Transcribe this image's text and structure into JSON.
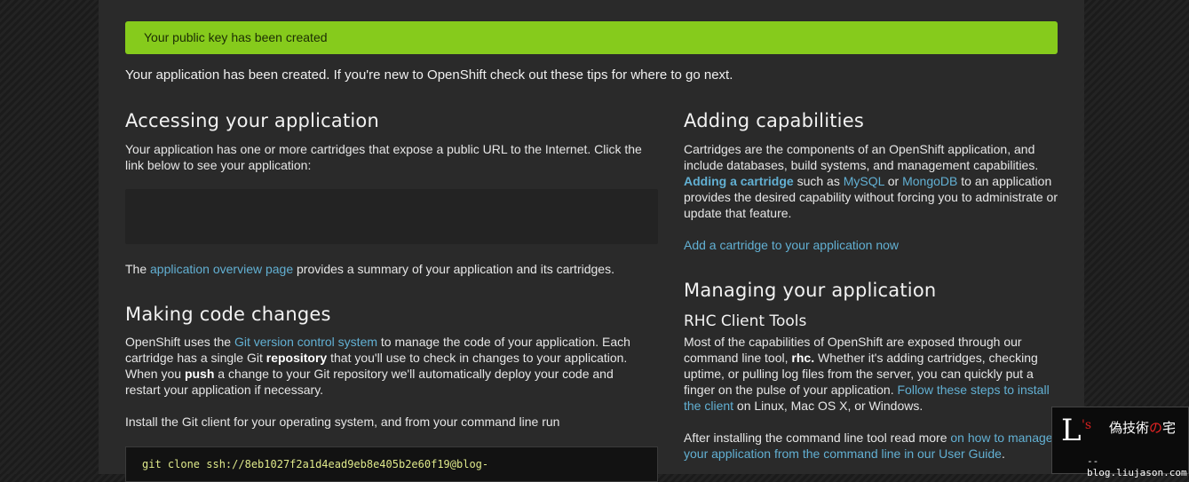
{
  "alert": {
    "text": "Your public key has been created"
  },
  "intro": "Your application has been created. If you're new to OpenShift check out these tips for where to go next.",
  "accessing": {
    "heading": "Accessing your application",
    "desc": "Your application has one or more cartridges that expose a public URL to the Internet. Click the link below to see your application:",
    "overview_prefix": "The ",
    "overview_link": "application overview page",
    "overview_suffix": " provides a summary of your application and its cartridges."
  },
  "code_changes": {
    "heading": "Making code changes",
    "p1_a": "OpenShift uses the ",
    "p1_link": "Git version control system",
    "p1_b": " to manage the code of your application. Each cartridge has a single Git ",
    "p1_bold1": "repository",
    "p1_c": " that you'll use to check in changes to your application. When you ",
    "p1_bold2": "push",
    "p1_d": " a change to your Git repository we'll automatically deploy your code and restart your application if necessary.",
    "p2": "Install the Git client for your operating system, and from your command line run",
    "command": "git clone ssh://8eb1027f2a1d4ead9eb8e405b2e60f19@blog-"
  },
  "capabilities": {
    "heading": "Adding capabilities",
    "p_a": "Cartridges are the components of an OpenShift application, and include databases, build systems, and management capabilities. ",
    "p_link_bold": "Adding a cartridge",
    "p_b": " such as ",
    "p_link_mysql": "MySQL",
    "p_c": " or ",
    "p_link_mongo": "MongoDB",
    "p_d": " to an application provides the desired capability without forcing you to administrate or update that feature.",
    "action_link": "Add a cartridge to your application now"
  },
  "managing": {
    "heading": "Managing your application",
    "subheading": "RHC Client Tools",
    "p1_a": "Most of the capabilities of OpenShift are exposed through our command line tool, ",
    "p1_bold": "rhc.",
    "p1_b": " Whether it's adding cartridges, checking uptime, or pulling log files from the server, you can quickly put a finger on the pulse of your application. ",
    "p1_link": "Follow these steps to install the client",
    "p1_c": " on Linux, Mac OS X, or Windows.",
    "p2_a": "After installing the command line tool read more ",
    "p2_link": "on how to manage your application from the command line in our User Guide",
    "p2_b": "."
  },
  "watermark": {
    "letter": "L",
    "super": "'s",
    "title_a": "偽技術",
    "title_b": "の",
    "title_c": "宅",
    "domain": "--blog.liujason.com"
  }
}
